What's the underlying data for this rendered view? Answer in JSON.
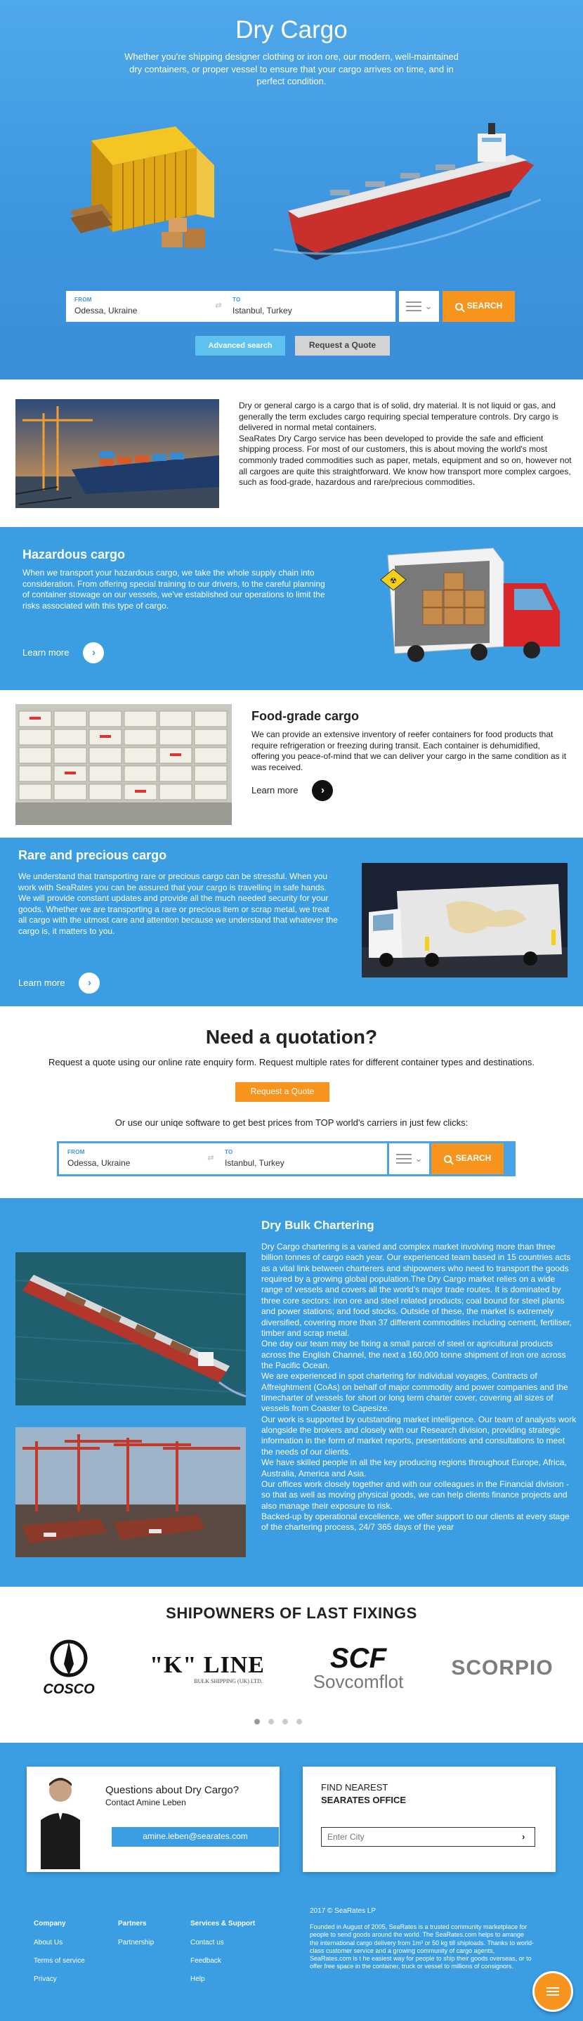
{
  "hero": {
    "title": "Dry Cargo",
    "subtitle": "Whether you're shipping designer clothing or iron ore, our modern, well-maintained dry containers, or proper vessel to ensure that your cargo arrives on time, and in perfect condition."
  },
  "search": {
    "from_label": "FROM",
    "from_value": "Odessa, Ukraine",
    "to_label": "TO",
    "to_value": "Istanbul, Turkey",
    "button": "SEARCH"
  },
  "hero_buttons": {
    "advanced": "Advanced search",
    "quote": "Request a Quote"
  },
  "intro": {
    "paragraphs": [
      "Dry or general cargo is a cargo that is of solid, dry material. It is not liquid or gas, and generally the term excludes cargo requiring special temperature controls. Dry cargo is delivered in normal metal containers.",
      "SeaRates Dry Cargo service has been developed to provide the safe and efficient shipping process. For most of our customers, this is about moving the world's most commonly traded commodities such as paper, metals, equipment and so on, however not all cargoes are quite this straightforward. We know how transport more complex cargoes, such as food-grade, hazardous and rare/precious commodities."
    ]
  },
  "hazardous": {
    "title": "Hazardous cargo",
    "text": "When we transport your hazardous cargo, we take the whole supply chain into consideration. From offering special training to our drivers, to the careful planning of container stowage on our vessels, we've established our operations to limit the risks associated with this type of cargo.",
    "learn_more": "Learn more"
  },
  "food": {
    "title": "Food-grade cargo",
    "text": "We can provide an extensive inventory of reefer containers for food products that require refrigeration or freezing during transit. Each container is dehumidified, offering you peace-of-mind that we can deliver your cargo in the same condition as it was received.",
    "learn_more": "Learn more"
  },
  "rare": {
    "title": "Rare and precious cargo",
    "text": "We understand that transporting rare or precious cargo can be stressful. When you work with SeaRates you can be assured that your cargo is travelling in safe hands. We will provide constant updates and provide all the much needed security for your goods. Whether we are transporting a rare or precious item or scrap metal, we treat all cargo with the utmost care and attention because we understand that whatever the cargo is, it matters to you.",
    "learn_more": "Learn more"
  },
  "quotation": {
    "title": "Need a quotation?",
    "subtitle": "Request a quote using our online rate enquiry form. Request multiple rates for different container types and destinations.",
    "button": "Request a Quote",
    "or_text": "Or use our uniqe software to get best prices from TOP world's carriers in just few clicks:"
  },
  "bulk": {
    "title": "Dry Bulk Chartering",
    "paragraphs": [
      "Dry Cargo chartering is a varied and complex market involving more than three billion tonnes of cargo each year. Our experienced team based in 15 countries acts as a vital link between charterers and shipowners who need to transport the goods required by a growing global population.The Dry Cargo market relies on a wide range of vessels and covers all the world's major trade routes. It is dominated by three core sectors: iron ore and steel related products; coal bound for steel plants and power stations; and food stocks. Outside of these, the market is extremely diversified, covering more than 37 different commodities including cement, fertiliser, timber and scrap metal.",
      "One day our team may be fixing a small parcel of steel or agricultural products across the English Channel, the next a 160,000 tonne shipment of iron ore across the Pacific Ocean.",
      "We are experienced in spot chartering for individual voyages, Contracts of Affreightment (CoAs) on behalf of major commodity and power companies and the timecharter of vessels for short or long term charter cover, covering all sizes of vessels from Coaster to Capesize.",
      "Our work is supported by outstanding market intelligence. Our team of analysts work alongside the brokers and closely with our Research division, providing strategic information in the form of market reports, presentations and consultations to meet the needs of our clients.",
      "We have skilled people in all the key producing regions throughout Europe, Africa, Australia, America and Asia.",
      "Our offices work closely together and with our colleagues in the Financial division - so that as well as moving physical goods, we can help clients finance projects and also manage their exposure to risk.",
      "Backed-up by operational excellence, we offer support to our clients at every stage of the chartering process, 24/7 365 days of the year"
    ]
  },
  "owners": {
    "title": "SHIPOWNERS OF LAST FIXINGS",
    "logos": [
      {
        "name": "COSCO",
        "text": "COSCO"
      },
      {
        "name": "K LINE",
        "text": "\"K\" LINE",
        "sub": "BULK SHIPPING (UK) LTD."
      },
      {
        "name": "SCF Sovcomflot",
        "text": "SCF",
        "sub": "Sovcomflot"
      },
      {
        "name": "Scorpio",
        "text": "SCORPIO"
      }
    ]
  },
  "contact": {
    "question": "Questions about Dry Cargo?",
    "person": "Contact Amine Leben",
    "email": "amine.leben@searates.com",
    "find_line1": "FIND NEAREST",
    "find_line2": "SEARATES OFFICE",
    "city_placeholder": "Enter City"
  },
  "footer": {
    "columns": [
      {
        "heading": "Company",
        "links": [
          "About Us",
          "Terms of service",
          "Privacy"
        ]
      },
      {
        "heading": "Partners",
        "links": [
          "Partnership"
        ]
      },
      {
        "heading": "Services & Support",
        "links": [
          "Contact us",
          "Feedback",
          "Help"
        ]
      }
    ],
    "copyright": "2017 © SeaRates LP",
    "about": "Founded in August of 2005, SeaRates is a trusted community marketplace for people to send goods around the world. The SeaRates.com helps to arrange the international cargo delivery from 1m³ or 50 kg till shiploads. Thanks to world-class customer service and a growing community of cargo agents, SeaRates.com is t he easiest way for people to ship their goods overseas, or to offer free space in the container, truck or vessel to millions of consignors."
  },
  "colors": {
    "primary_blue": "#3b9de2",
    "accent_orange": "#f7941d"
  }
}
